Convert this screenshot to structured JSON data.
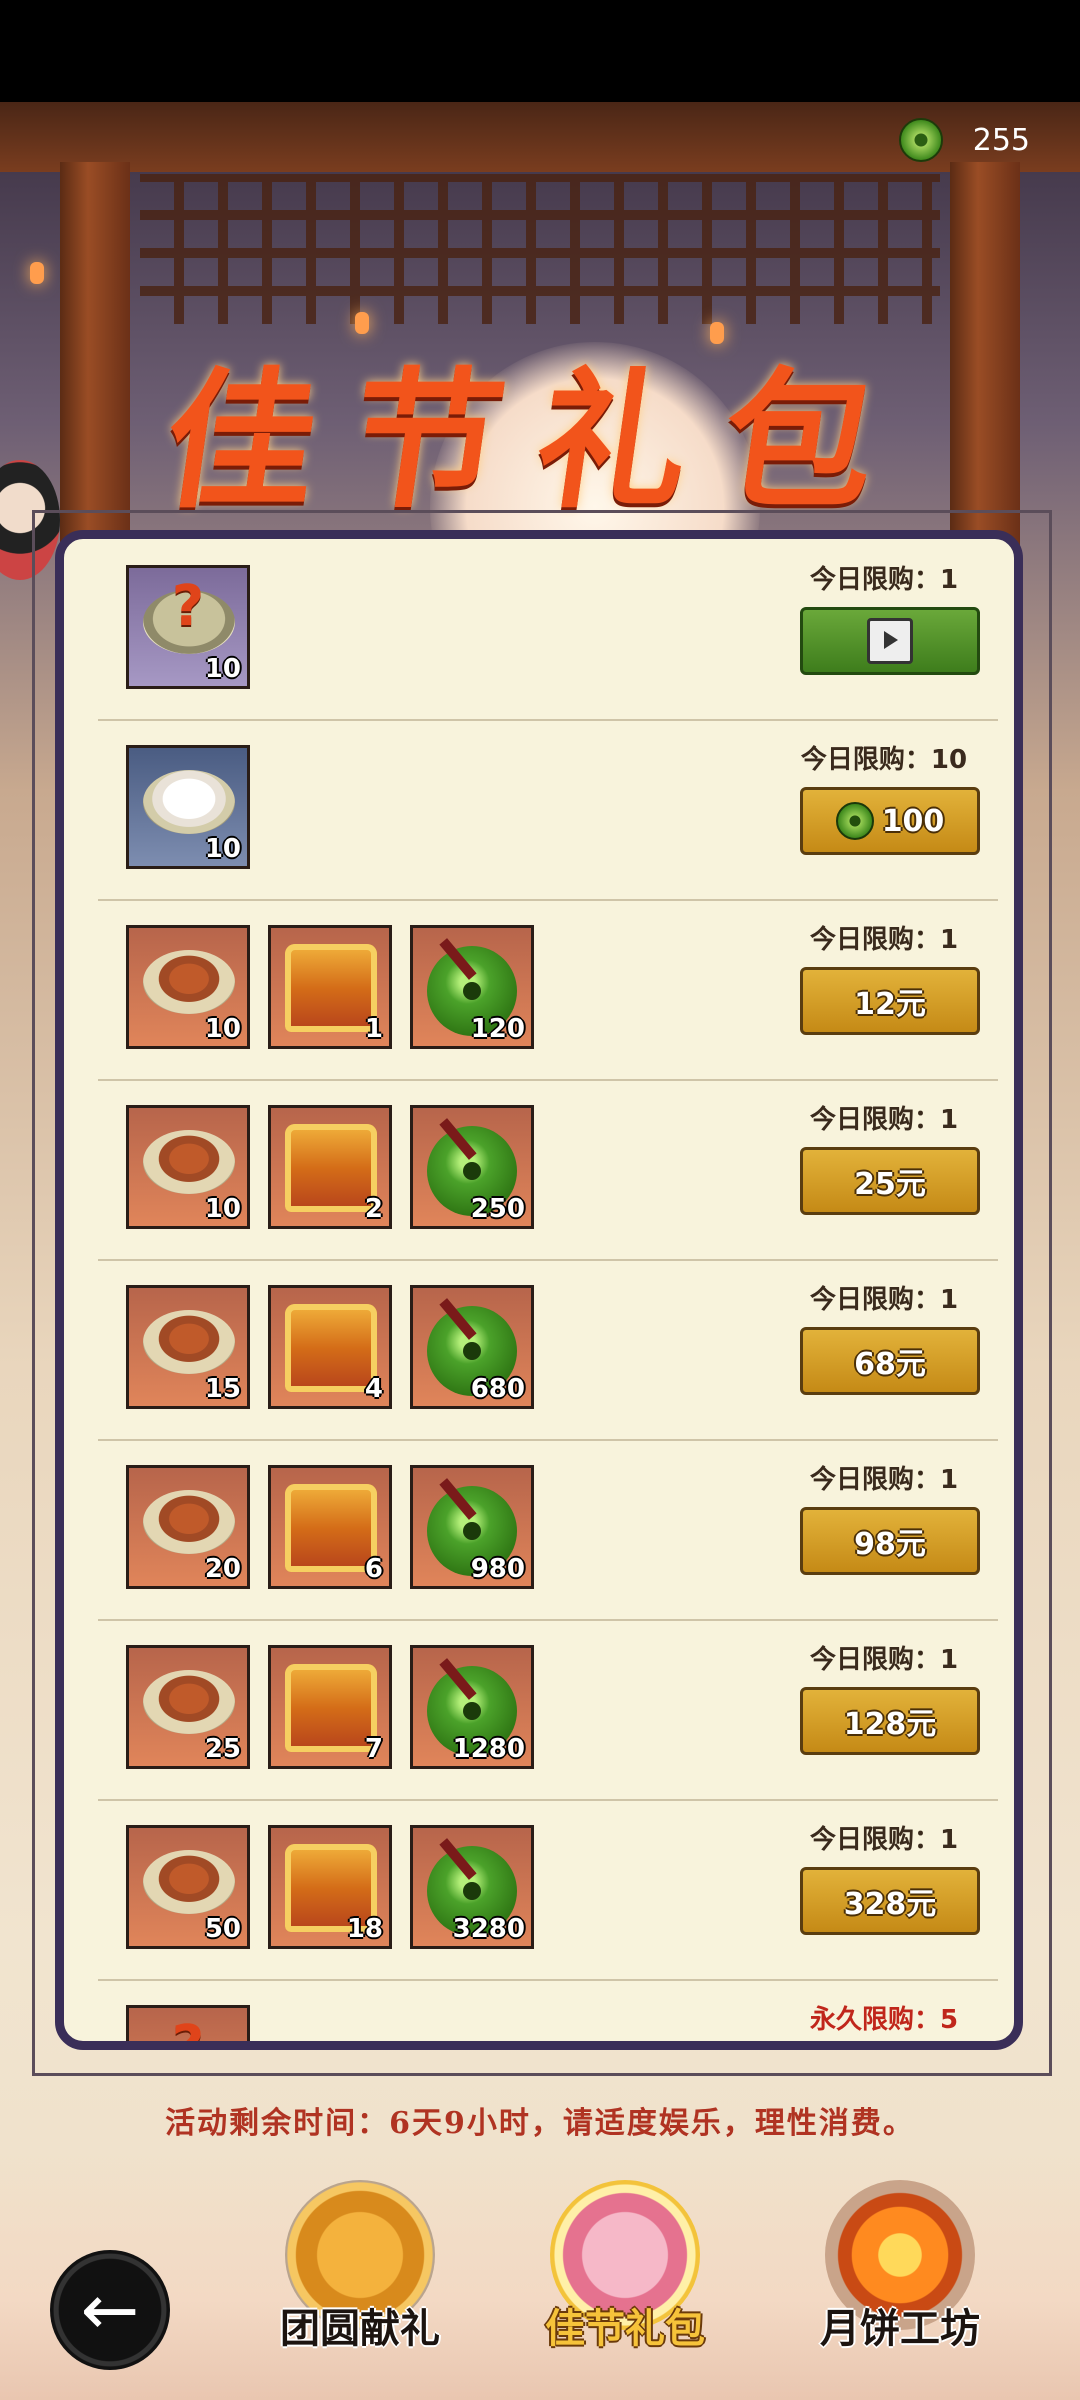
{
  "header": {
    "currency": {
      "icon": "jade-coin-icon",
      "value": "255"
    },
    "title": "佳节礼包"
  },
  "packs": [
    {
      "items": [
        {
          "icon": "mystery-plate-icon",
          "qty": "10"
        }
      ],
      "limit": "今日限购：1",
      "button": {
        "type": "video",
        "icon": "video-ad-icon",
        "label": ""
      }
    },
    {
      "items": [
        {
          "icon": "rice-plate-icon",
          "qty": "10"
        }
      ],
      "limit": "今日限购：10",
      "button": {
        "type": "currency",
        "icon": "jade-coin-icon",
        "label": "100"
      }
    },
    {
      "items": [
        {
          "icon": "food-plate-icon",
          "qty": "10"
        },
        {
          "icon": "treasure-chest-icon",
          "qty": "1"
        },
        {
          "icon": "jade-disc-icon",
          "qty": "120"
        }
      ],
      "limit": "今日限购：1",
      "button": {
        "type": "price",
        "label": "12元"
      }
    },
    {
      "items": [
        {
          "icon": "food-plate-icon",
          "qty": "10"
        },
        {
          "icon": "treasure-chest-icon",
          "qty": "2"
        },
        {
          "icon": "jade-disc-icon",
          "qty": "250"
        }
      ],
      "limit": "今日限购：1",
      "button": {
        "type": "price",
        "label": "25元"
      }
    },
    {
      "items": [
        {
          "icon": "food-plate-icon",
          "qty": "15"
        },
        {
          "icon": "treasure-chest-icon",
          "qty": "4"
        },
        {
          "icon": "jade-disc-icon",
          "qty": "680"
        }
      ],
      "limit": "今日限购：1",
      "button": {
        "type": "price",
        "label": "68元"
      }
    },
    {
      "items": [
        {
          "icon": "food-plate-icon",
          "qty": "20"
        },
        {
          "icon": "treasure-chest-icon",
          "qty": "6"
        },
        {
          "icon": "jade-disc-icon",
          "qty": "980"
        }
      ],
      "limit": "今日限购：1",
      "button": {
        "type": "price",
        "label": "98元"
      }
    },
    {
      "items": [
        {
          "icon": "food-plate-icon",
          "qty": "25"
        },
        {
          "icon": "treasure-chest-icon",
          "qty": "7"
        },
        {
          "icon": "jade-disc-icon",
          "qty": "1280"
        }
      ],
      "limit": "今日限购：1",
      "button": {
        "type": "price",
        "label": "128元"
      }
    },
    {
      "items": [
        {
          "icon": "food-plate-icon",
          "qty": "50"
        },
        {
          "icon": "treasure-chest-icon",
          "qty": "18"
        },
        {
          "icon": "jade-disc-icon",
          "qty": "3280"
        }
      ],
      "limit": "今日限购：1",
      "button": {
        "type": "price",
        "label": "328元"
      }
    },
    {
      "items": [
        {
          "icon": "mystery-plate-icon",
          "qty": ""
        }
      ],
      "limit": "永久限购：5",
      "limit_color": "#c0261b"
    }
  ],
  "notice": "活动剩余时间：6天9小时，请适度娱乐，理性消费。",
  "bottom_nav": {
    "back_icon": "back-arrow-icon",
    "tabs": [
      {
        "label": "团圆献礼",
        "icon": "mooncake-icon",
        "active": false
      },
      {
        "label": "佳节礼包",
        "icon": "gift-box-icon",
        "active": true
      },
      {
        "label": "月饼工坊",
        "icon": "bonfire-icon",
        "active": false
      }
    ]
  },
  "colors": {
    "panel_bg": "#f8f3dc",
    "panel_border": "#3a2e58",
    "title": "#f2541b",
    "gold_button": "#d9a429",
    "green_button": "#52962b",
    "notice": "#b03322"
  }
}
